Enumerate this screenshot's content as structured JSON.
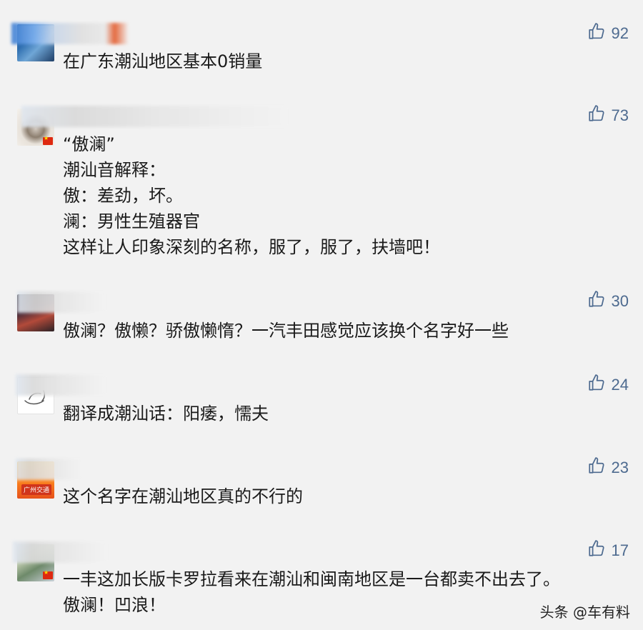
{
  "comments": [
    {
      "likes": "92",
      "lines": [
        "在广东潮汕地区基本0销量"
      ]
    },
    {
      "likes": "73",
      "lines": [
        "“傲澜”",
        "潮汕音解释：",
        "傲：差劲，坏。",
        "澜：男性生殖器官",
        "这样让人印象深刻的名称，服了，服了，扶墙吧！"
      ]
    },
    {
      "likes": "30",
      "lines": [
        "傲澜？傲懒？骄傲懒惰？一汽丰田感觉应该换个名字好一些"
      ]
    },
    {
      "likes": "24",
      "lines": [
        "翻译成潮汕话：阳痿，懦夫"
      ]
    },
    {
      "likes": "23",
      "lines": [
        "这个名字在潮汕地区真的不行的"
      ],
      "avatar_badge": "广州交通"
    },
    {
      "likes": "17",
      "lines": [
        "一丰这加长版卡罗拉看来在潮汕和闽南地区是一台都卖不出去了。",
        "傲澜！凹浪！"
      ]
    }
  ],
  "watermark": "头条 @车有料",
  "icons": {
    "like": "thumbs-up-icon"
  },
  "colors": {
    "background": "#f2f2f2",
    "like_color": "#4d6a8f",
    "text": "#1a1a1a"
  }
}
